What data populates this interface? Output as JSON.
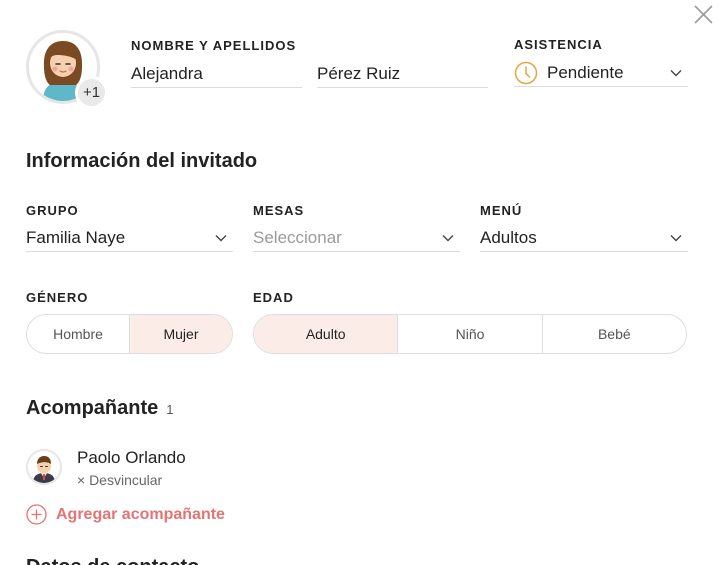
{
  "guest": {
    "plus_count": "+1",
    "name_label": "NOMBRE Y APELLIDOS",
    "first_name": "Alejandra",
    "last_name": "Pérez Ruiz",
    "attendance_label": "ASISTENCIA",
    "attendance_value": "Pendiente"
  },
  "info": {
    "title": "Información del invitado",
    "group_label": "GRUPO",
    "group_value": "Familia Naye",
    "tables_label": "MESAS",
    "tables_placeholder": "Seleccionar",
    "menu_label": "MENÚ",
    "menu_value": "Adultos",
    "gender_label": "GÉNERO",
    "gender_options": [
      "Hombre",
      "Mujer"
    ],
    "gender_selected": "Mujer",
    "age_label": "EDAD",
    "age_options": [
      "Adulto",
      "Niño",
      "Bebé"
    ],
    "age_selected": "Adulto"
  },
  "companions": {
    "title": "Acompañante",
    "count": "1",
    "items": [
      {
        "name": "Paolo Orlando",
        "unlink_label": "× Desvincular"
      }
    ],
    "add_label": "Agregar acompañante"
  },
  "next_section": {
    "title": "Datos de contacto"
  },
  "colors": {
    "accent": "#e57373",
    "selected_bg": "#fbece7",
    "clock": "#e3a740"
  },
  "icons": {
    "close": "close-icon",
    "clock": "clock-icon",
    "chevron": "chevron-down-icon",
    "add": "plus-circle-icon"
  }
}
